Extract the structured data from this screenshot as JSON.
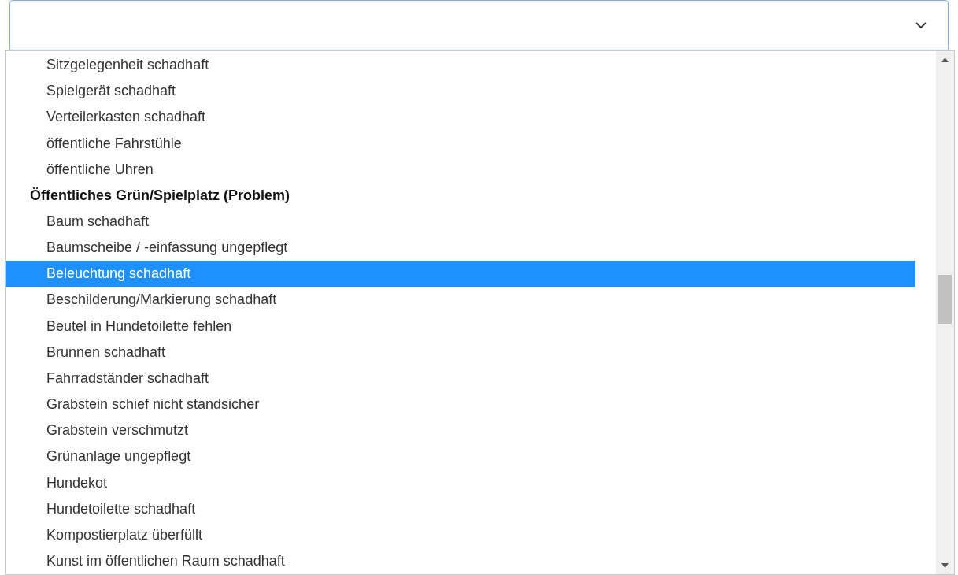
{
  "select": {
    "expanded": true
  },
  "options": [
    {
      "kind": "option",
      "label": "Sitzgelegenheit schadhaft",
      "selected": false
    },
    {
      "kind": "option",
      "label": "Spielgerät schadhaft",
      "selected": false
    },
    {
      "kind": "option",
      "label": "Verteilerkasten schadhaft",
      "selected": false
    },
    {
      "kind": "option",
      "label": "öffentliche Fahrstühle",
      "selected": false
    },
    {
      "kind": "option",
      "label": "öffentliche Uhren",
      "selected": false
    },
    {
      "kind": "group",
      "label": "Öffentliches Grün/Spielplatz (Problem)"
    },
    {
      "kind": "option",
      "label": "Baum schadhaft",
      "selected": false
    },
    {
      "kind": "option",
      "label": "Baumscheibe / -einfassung ungepflegt",
      "selected": false
    },
    {
      "kind": "option",
      "label": "Beleuchtung schadhaft",
      "selected": true
    },
    {
      "kind": "option",
      "label": "Beschilderung/Markierung schadhaft",
      "selected": false
    },
    {
      "kind": "option",
      "label": "Beutel in Hundetoilette fehlen",
      "selected": false
    },
    {
      "kind": "option",
      "label": "Brunnen schadhaft",
      "selected": false
    },
    {
      "kind": "option",
      "label": "Fahrradständer schadhaft",
      "selected": false
    },
    {
      "kind": "option",
      "label": "Grabstein schief nicht standsicher",
      "selected": false
    },
    {
      "kind": "option",
      "label": "Grabstein verschmutzt",
      "selected": false
    },
    {
      "kind": "option",
      "label": "Grünanlage ungepflegt",
      "selected": false
    },
    {
      "kind": "option",
      "label": "Hundekot",
      "selected": false
    },
    {
      "kind": "option",
      "label": "Hundetoilette schadhaft",
      "selected": false
    },
    {
      "kind": "option",
      "label": "Kompostierplatz überfüllt",
      "selected": false
    },
    {
      "kind": "option",
      "label": "Kunst im öffentlichen Raum schadhaft",
      "selected": false
    }
  ]
}
